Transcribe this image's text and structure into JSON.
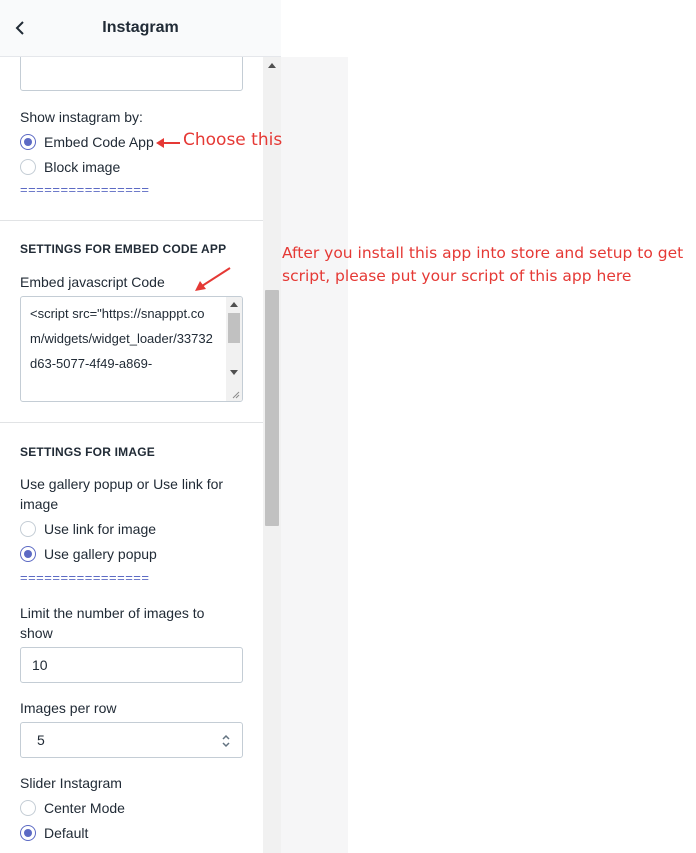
{
  "header": {
    "title": "Instagram",
    "back_icon": "chevron-left-icon"
  },
  "show_by": {
    "label": "Show instagram by:",
    "options": [
      "Embed Code App",
      "Block image"
    ],
    "selected": "Embed Code App",
    "divider": "================"
  },
  "embed_section": {
    "title": "SETTINGS FOR EMBED CODE APP",
    "code_label": "Embed javascript Code",
    "code_value": "<script src=\"https://snapppt.com/widgets/widget_loader/33732d63-5077-4f49-a869-"
  },
  "image_section": {
    "title": "SETTINGS FOR IMAGE",
    "popup_label": "Use gallery popup or Use link for image",
    "options": [
      "Use link for image",
      "Use gallery popup"
    ],
    "selected": "Use gallery popup",
    "divider": "================",
    "limit_label": "Limit the number of images to show",
    "limit_value": "10",
    "per_row_label": "Images per row",
    "per_row_value": "5",
    "slider_label": "Slider Instagram",
    "slider_options": [
      "Center Mode",
      "Default"
    ],
    "slider_selected": "Default"
  },
  "annotations": {
    "choose": "Choose this",
    "instruction": "After you install this app into store and setup to get script, please put your script of this app here",
    "color": "#e53935"
  },
  "colors": {
    "accent": "#5c6ac4",
    "panel_gray": "#f6f6f7"
  }
}
